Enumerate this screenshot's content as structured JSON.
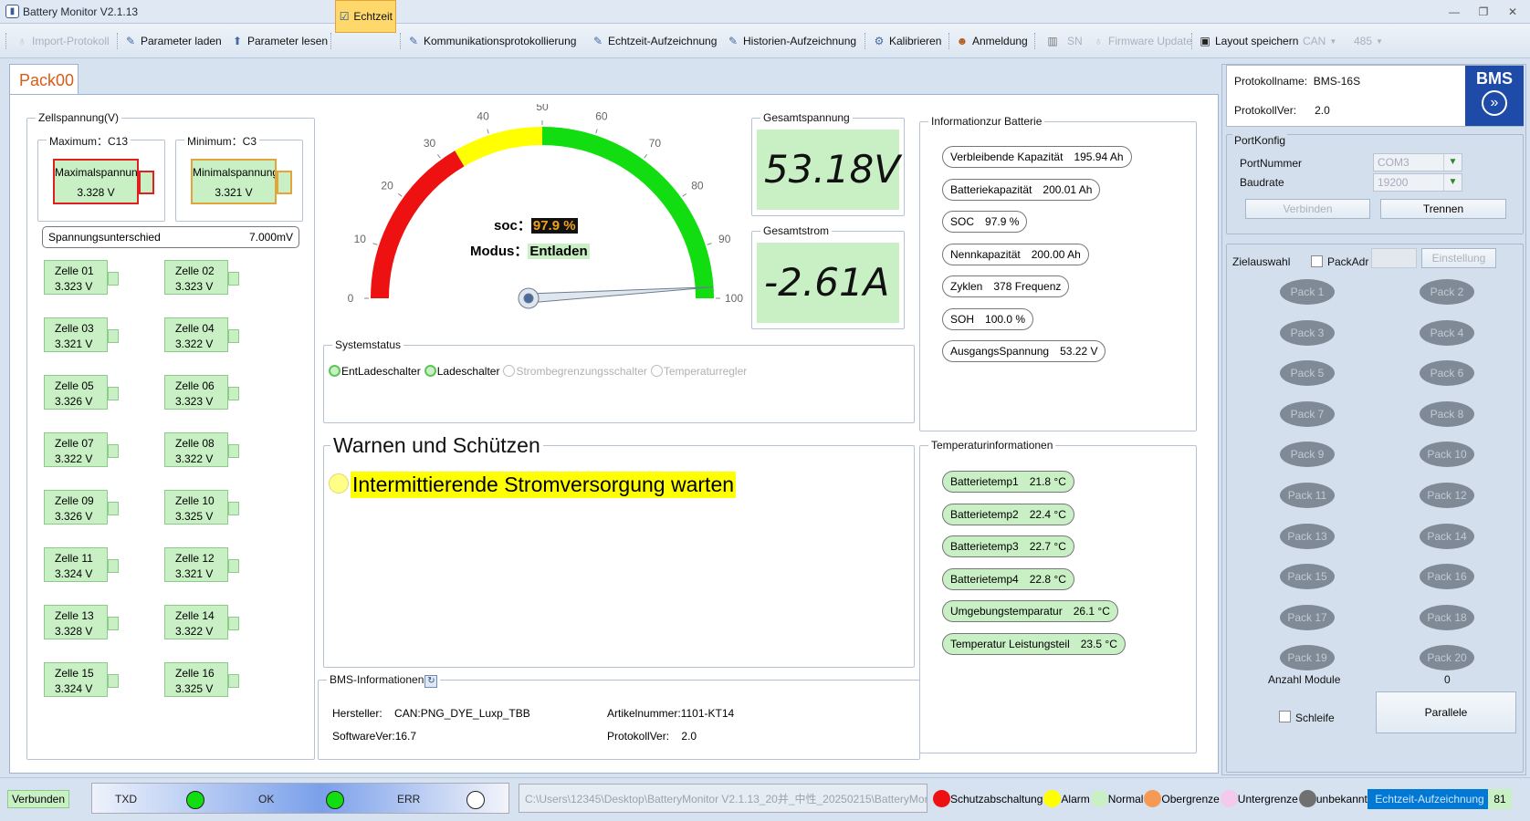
{
  "window": {
    "title": "Battery Monitor V2.1.13"
  },
  "toolbar": {
    "import_protokoll": "Import-Protokoll",
    "parameter_laden": "Parameter laden",
    "parameter_lesen": "Parameter lesen",
    "echtzeit": "Echtzeit",
    "kommunikation": "Kommunikationsprotokollierung",
    "echtzeit_aufzeichnung": "Echtzeit-Aufzeichnung",
    "historien": "Historien-Aufzeichnung",
    "kalibrieren": "Kalibrieren",
    "anmeldung": "Anmeldung",
    "sn": "SN",
    "firmware": "Firmware Update",
    "layout": "Layout speichern",
    "can": "CAN",
    "p485": "485"
  },
  "tab": {
    "label": "Pack00"
  },
  "zell": {
    "title": "Zellspannung(V)",
    "max_title": "Maximum：C13",
    "min_title": "Minimum：C3",
    "max_label": "Maximalspannung",
    "max_value": "3.328 V",
    "min_label": "Minimalspannung",
    "min_value": "3.321 V",
    "diff_label": "Spannungsunterschied",
    "diff_value": "7.000mV",
    "cells": [
      {
        "name": "Zelle 01",
        "value": "3.323 V"
      },
      {
        "name": "Zelle 02",
        "value": "3.323 V"
      },
      {
        "name": "Zelle 03",
        "value": "3.321 V"
      },
      {
        "name": "Zelle 04",
        "value": "3.322 V"
      },
      {
        "name": "Zelle 05",
        "value": "3.326 V"
      },
      {
        "name": "Zelle 06",
        "value": "3.323 V"
      },
      {
        "name": "Zelle 07",
        "value": "3.322 V"
      },
      {
        "name": "Zelle 08",
        "value": "3.322 V"
      },
      {
        "name": "Zelle 09",
        "value": "3.326 V"
      },
      {
        "name": "Zelle 10",
        "value": "3.325 V"
      },
      {
        "name": "Zelle 11",
        "value": "3.324 V"
      },
      {
        "name": "Zelle 12",
        "value": "3.321 V"
      },
      {
        "name": "Zelle 13",
        "value": "3.328 V"
      },
      {
        "name": "Zelle 14",
        "value": "3.322 V"
      },
      {
        "name": "Zelle 15",
        "value": "3.324 V"
      },
      {
        "name": "Zelle 16",
        "value": "3.325 V"
      }
    ]
  },
  "gauge": {
    "soc_label": "soc：",
    "soc_value": "97.9 %",
    "soc_percent": 97.9,
    "modus_label": "Modus：",
    "modus_value": "Entladen",
    "ticks": [
      "0",
      "10",
      "20",
      "30",
      "40",
      "50",
      "60",
      "70",
      "80",
      "90",
      "100"
    ],
    "colors": {
      "red": "#ee1111",
      "yellow": "#ffff00",
      "green": "#11dd11"
    }
  },
  "gesamt": {
    "spannung_title": "Gesamtspannung",
    "spannung_value": "53.18V",
    "strom_title": "Gesamtstrom",
    "strom_value": "-2.61A"
  },
  "info": {
    "title": "Informationzur Batterie",
    "items": [
      {
        "label": "Verbleibende Kapazität",
        "value": "195.94 Ah"
      },
      {
        "label": "Batteriekapazität",
        "value": "200.01 Ah"
      },
      {
        "label": "SOC",
        "value": "97.9 %"
      },
      {
        "label": "Nennkapazität",
        "value": "200.00 Ah"
      },
      {
        "label": "Zyklen",
        "value": "378 Frequenz"
      },
      {
        "label": "SOH",
        "value": "100.0 %"
      },
      {
        "label": "AusgangsSpannung",
        "value": "53.22 V"
      }
    ]
  },
  "system": {
    "title": "Systemstatus",
    "items": [
      {
        "label": "EntLadeschalter",
        "on": true
      },
      {
        "label": "Ladeschalter",
        "on": true
      },
      {
        "label": "Strombegrenzungsschalter",
        "on": false
      },
      {
        "label": "Temperaturregler",
        "on": false
      }
    ]
  },
  "warn": {
    "title": "Warnen und Schützen",
    "message": "Intermittierende Stromversorgung warten"
  },
  "temp": {
    "title": "Temperaturinformationen",
    "items": [
      {
        "label": "Batterietemp1",
        "value": "21.8 °C"
      },
      {
        "label": "Batterietemp2",
        "value": "22.4 °C"
      },
      {
        "label": "Batterietemp3",
        "value": "22.7 °C"
      },
      {
        "label": "Batterietemp4",
        "value": "22.8 °C"
      },
      {
        "label": "Umgebungstemparatur",
        "value": "26.1 °C"
      },
      {
        "label": "Temperatur Leistungsteil",
        "value": "23.5 °C"
      }
    ]
  },
  "bms": {
    "title": "BMS-Informationen",
    "hersteller_label": "Hersteller:",
    "hersteller_value": "CAN:PNG_DYE_Luxp_TBB",
    "artikel_label": "Artikelnummer:",
    "artikel_value": "1101-KT14",
    "software_label": "SoftwareVer:",
    "software_value": "16.7",
    "protokoll_label": "ProtokollVer:",
    "protokoll_value": "2.0"
  },
  "right": {
    "protokollname_label": "Protokollname:",
    "protokollname_value": "BMS-16S",
    "protokollver_label": "ProtokollVer:",
    "protokollver_value": "2.0",
    "logo_text": "BMS",
    "port_title": "PortKonfig",
    "portnummer_label": "PortNummer",
    "portnummer_value": "COM3",
    "baudrate_label": "Baudrate",
    "baudrate_value": "19200",
    "verbinden": "Verbinden",
    "trennen": "Trennen",
    "ziel_title": "Zielauswahl",
    "packadr_label": "PackAdr",
    "einstellung": "Einstellung",
    "packs": [
      "Pack 1",
      "Pack 2",
      "Pack 3",
      "Pack 4",
      "Pack 5",
      "Pack 6",
      "Pack 7",
      "Pack 8",
      "Pack 9",
      "Pack 10",
      "Pack 11",
      "Pack 12",
      "Pack 13",
      "Pack 14",
      "Pack 15",
      "Pack 16",
      "Pack 17",
      "Pack 18",
      "Pack 19",
      "Pack 20"
    ],
    "anzahl_label": "Anzahl Module",
    "anzahl_value": "0",
    "schleife": "Schleife",
    "parallele": "Parallele"
  },
  "status": {
    "verbunden": "Verbunden",
    "txd": "TXD",
    "ok": "OK",
    "err": "ERR",
    "path": "C:\\Users\\12345\\Desktop\\BatteryMonitor V2.1.13_20并_中性_20250215\\BatteryMoni",
    "legend": [
      {
        "label": "Schutzabschaltung",
        "color": "#ee1111"
      },
      {
        "label": "Alarm",
        "color": "#ffff00"
      },
      {
        "label": "Normal",
        "color": "#c9efc5"
      },
      {
        "label": "Obergrenze",
        "color": "#f59a55"
      },
      {
        "label": "Untergrenze",
        "color": "#f3c9ec"
      },
      {
        "label": "unbekannt",
        "color": "#707070"
      }
    ],
    "echtzeit": "Echtzeit-Aufzeichnung",
    "count": "81"
  }
}
